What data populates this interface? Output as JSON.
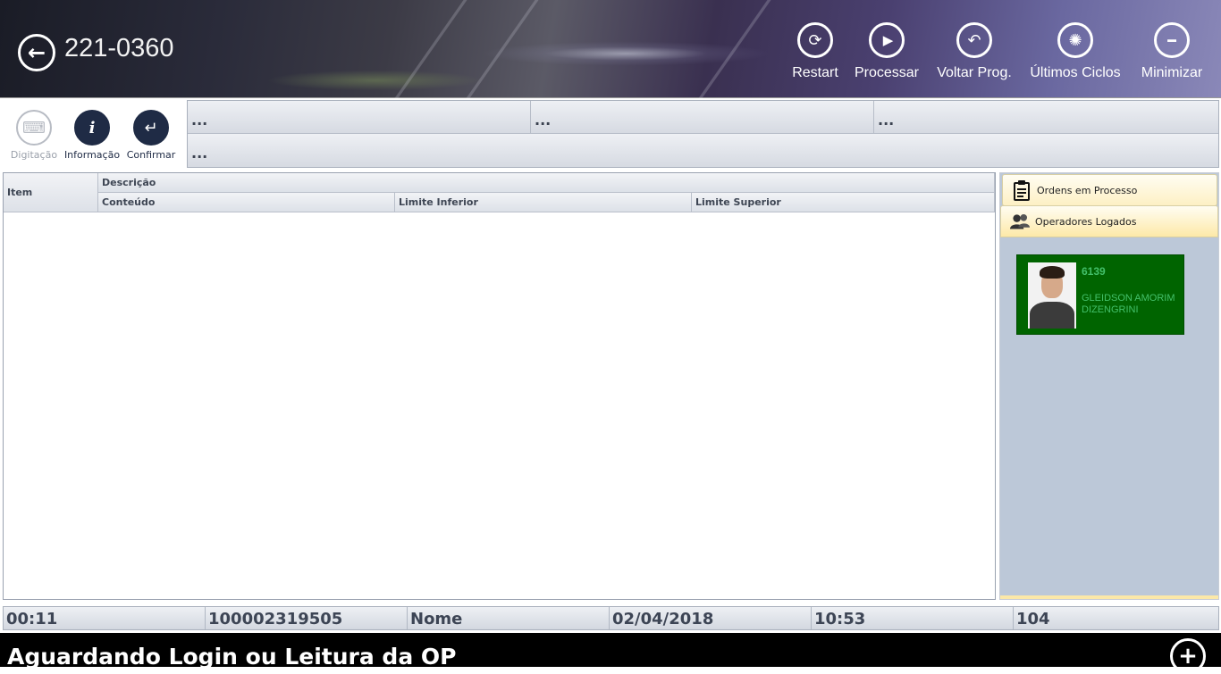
{
  "header": {
    "back_icon": "arrow-left-icon",
    "machine_code": "221-0360",
    "actions": [
      {
        "label": "Restart",
        "icon": "refresh-icon",
        "glyph": "⟳"
      },
      {
        "label": "Processar",
        "icon": "play-icon",
        "glyph": "▶"
      },
      {
        "label": "Voltar Prog.",
        "icon": "undo-icon",
        "glyph": "↶"
      },
      {
        "label": "Últimos Ciclos",
        "icon": "lightbulb-icon",
        "glyph": "✺"
      },
      {
        "label": "Minimizar",
        "icon": "minus-icon",
        "glyph": "━"
      }
    ]
  },
  "toolbar": {
    "digitacao_label": "Digitação",
    "informacao_label": "Informação",
    "confirmar_label": "Confirmar"
  },
  "info_grid": {
    "cells": [
      "...",
      "...",
      "...",
      "..."
    ]
  },
  "table": {
    "col_item": "Item",
    "col_descricao": "Descrição",
    "col_conteudo": "Conteúdo",
    "col_limite_inferior": "Limite Inferior",
    "col_limite_superior": "Limite Superior",
    "rows": []
  },
  "side_panel": {
    "tab_ordens": "Ordens em Processo",
    "tab_operadores": "Operadores Logados",
    "operator": {
      "id": "6139",
      "name": "GLEIDSON AMORIM DIZENGRINI"
    }
  },
  "status_bar": {
    "time_elapsed": "00:11",
    "op_number": "100002319505",
    "name": "Nome",
    "date": "02/04/2018",
    "clock": "10:53",
    "count": "104"
  },
  "message_bar": {
    "text": "Aguardando Login ou Leitura da OP",
    "plus_icon": "plus-icon"
  },
  "colors": {
    "operator_card": "#006400",
    "operator_text": "#43c06a",
    "message_bar": "#000000",
    "side_panel": "#bcc8d8",
    "toolbar_icon_dark": "#1f2b45"
  }
}
